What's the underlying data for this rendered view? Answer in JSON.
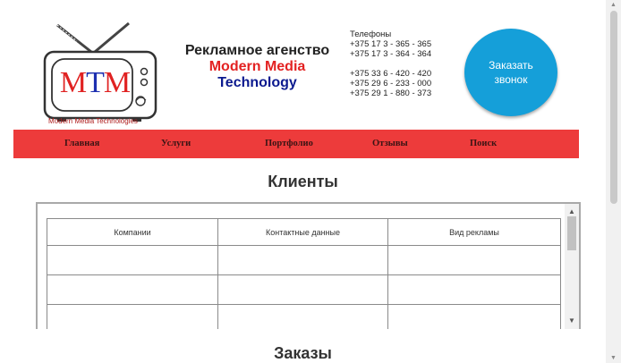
{
  "logo": {
    "letters": "MTM",
    "caption": "Modern Media Technologies"
  },
  "agency": {
    "line1": "Рекламное агенство",
    "line2": "Modern Media",
    "line3": "Technology"
  },
  "phones": {
    "label": "Телефоны",
    "group1": [
      "+375 17 3 - 365 - 365",
      "+375 17 3 - 364 - 364"
    ],
    "group2": [
      "+375 33 6 - 420 - 420",
      "+375 29 6 - 233 - 000",
      "+375 29 1 - 880 - 373"
    ]
  },
  "call_button": {
    "line1": "Заказать",
    "line2": "звонок"
  },
  "nav": {
    "items": [
      "Главная",
      "Услуги",
      "Портфолио",
      "Отзывы",
      "Поиск"
    ]
  },
  "clients": {
    "title": "Клиенты",
    "columns": [
      "Компании",
      "Контактные данные",
      "Вид рекламы"
    ],
    "rows": [
      [
        "",
        "",
        ""
      ],
      [
        "",
        "",
        ""
      ],
      [
        "",
        "",
        ""
      ]
    ]
  },
  "orders": {
    "title": "Заказы"
  },
  "colors": {
    "nav_bg": "#ed3b3b",
    "call_button_bg": "#159fd9",
    "agency_red": "#e32222",
    "agency_blue": "#0c1a8f"
  }
}
